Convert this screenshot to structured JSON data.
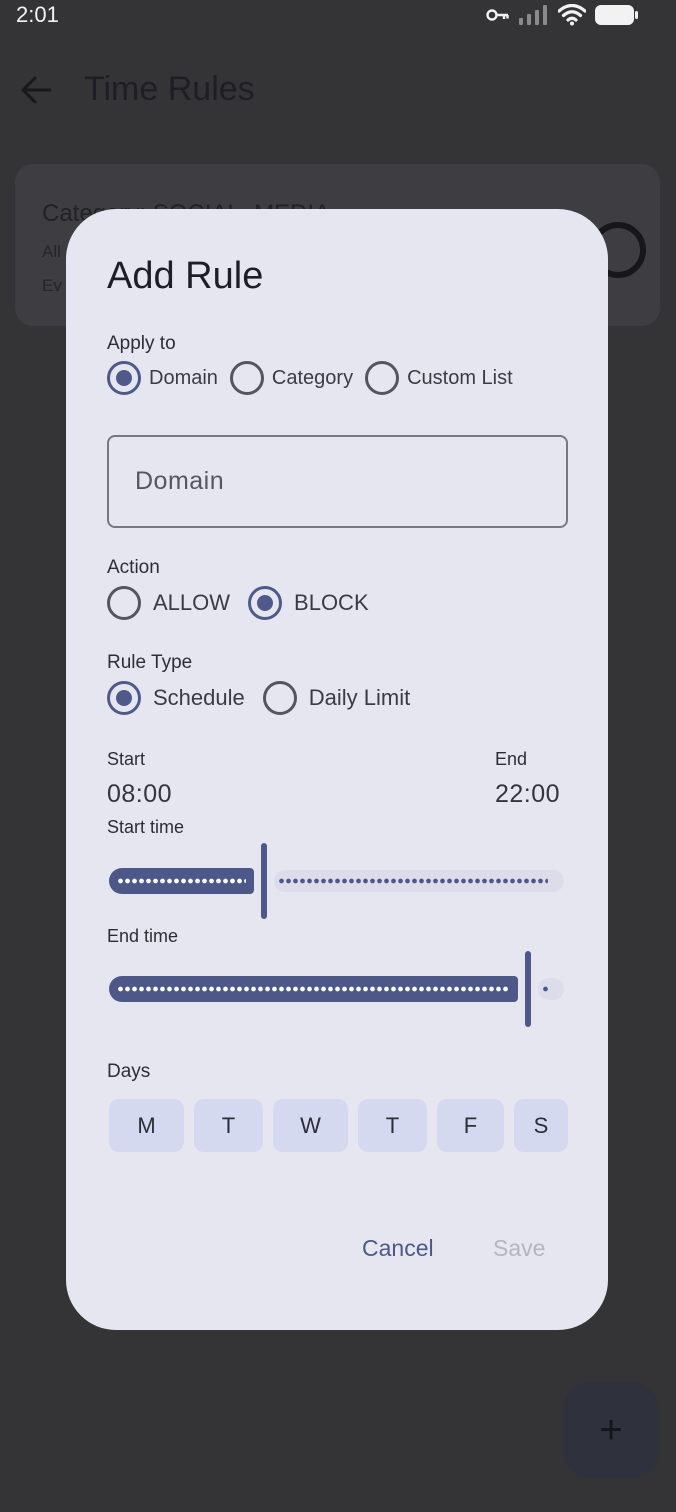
{
  "status_bar": {
    "time": "2:01"
  },
  "app": {
    "title": "Time Rules"
  },
  "card": {
    "category_line": "Category: SOCIAL_MEDIA",
    "line2": "All",
    "line3": "Ev"
  },
  "fab": {
    "icon": "+"
  },
  "dialog": {
    "title": "Add Rule",
    "apply_to": {
      "label": "Apply to",
      "options": [
        "Domain",
        "Category",
        "Custom List"
      ],
      "selected": "Domain"
    },
    "domain_field": {
      "placeholder": "Domain",
      "value": ""
    },
    "action": {
      "label": "Action",
      "options": [
        "ALLOW",
        "BLOCK"
      ],
      "selected": "BLOCK"
    },
    "rule_type": {
      "label": "Rule Type",
      "options": [
        "Schedule",
        "Daily Limit"
      ],
      "selected": "Schedule"
    },
    "start": {
      "label": "Start",
      "value": "08:00"
    },
    "end": {
      "label": "End",
      "value": "22:00"
    },
    "start_slider": {
      "label": "Start time",
      "fraction": 0.34
    },
    "end_slider": {
      "label": "End time",
      "fraction": 0.92
    },
    "days": {
      "label": "Days",
      "items": [
        "M",
        "T",
        "W",
        "T",
        "F",
        "S"
      ]
    },
    "cancel_label": "Cancel",
    "save_label": "Save"
  }
}
